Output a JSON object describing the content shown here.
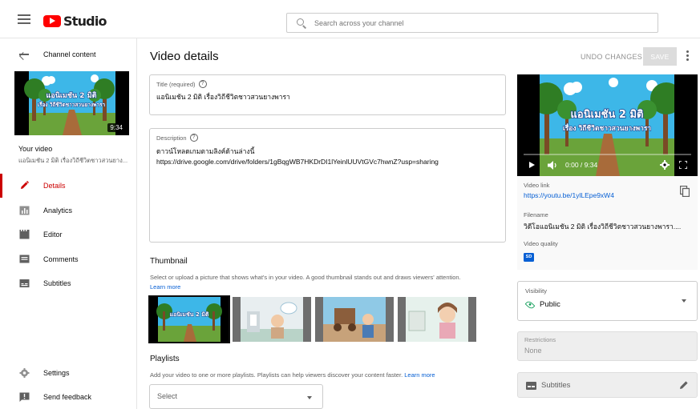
{
  "header": {
    "logo_text": "Studio",
    "search_placeholder": "Search across your channel"
  },
  "sidebar": {
    "back_label": "Channel content",
    "thumbnail_duration": "9:34",
    "your_video_label": "Your video",
    "your_video_title": "แอนิเมชัน 2 มิติ เรื่องวิถีชีวิตชาวสวนยาง...",
    "nav": [
      {
        "label": "Details",
        "icon": "pencil-icon",
        "active": true
      },
      {
        "label": "Analytics",
        "icon": "analytics-icon",
        "active": false
      },
      {
        "label": "Editor",
        "icon": "editor-icon",
        "active": false
      },
      {
        "label": "Comments",
        "icon": "comments-icon",
        "active": false
      },
      {
        "label": "Subtitles",
        "icon": "subtitles-icon",
        "active": false
      }
    ],
    "footer_nav": [
      {
        "label": "Settings",
        "icon": "gear-icon"
      },
      {
        "label": "Send feedback",
        "icon": "feedback-icon"
      }
    ]
  },
  "main": {
    "page_title": "Video details",
    "undo_label": "UNDO CHANGES",
    "save_label": "SAVE",
    "title_field": {
      "label": "Title (required)",
      "value": "แอนิเมชัน 2 มิติ เรื่องวิถีชีวิตชาวสวนยางพารา"
    },
    "description_field": {
      "label": "Description",
      "line1": "ดาวน์โหลดเกมตามลิงค์ด้านล่างนี้",
      "line2": "https://drive.google.com/drive/folders/1gBqgWB7HKDrDI1lYeinlUUVtGVc7hwnZ?usp=sharing"
    },
    "thumbnail": {
      "title": "Thumbnail",
      "description": "Select or upload a picture that shows what's in your video. A good thumbnail stands out and draws viewers' attention.",
      "learn_more": "Learn more"
    },
    "playlists": {
      "title": "Playlists",
      "description": "Add your video to one or more playlists. Playlists can help viewers discover your content faster.",
      "learn_more": "Learn more",
      "select_value": "Select"
    }
  },
  "right_panel": {
    "player": {
      "overlay_title": "แอนิเมชัน 2 มิติ",
      "overlay_subtitle": "เรื่อง วิถีชีวิตชาวสวนยางพารา",
      "time": "0:00 / 9:34"
    },
    "video_link_label": "Video link",
    "video_link": "https://youtu.be/1ylLEpe9xW4",
    "filename_label": "Filename",
    "filename": "วิดีโอแอนิเมชัน 2 มิติ เรื่องวิถีชีวิตชาวสวนยางพารา....",
    "video_quality_label": "Video quality",
    "quality_badge": "SD",
    "visibility_label": "Visibility",
    "visibility_value": "Public",
    "restrictions_label": "Restrictions",
    "restrictions_value": "None",
    "subtitles_label": "Subtitles"
  },
  "colors": {
    "accent_red": "#cc0000",
    "link_blue": "#065fd4",
    "public_green": "#0f9d58"
  }
}
